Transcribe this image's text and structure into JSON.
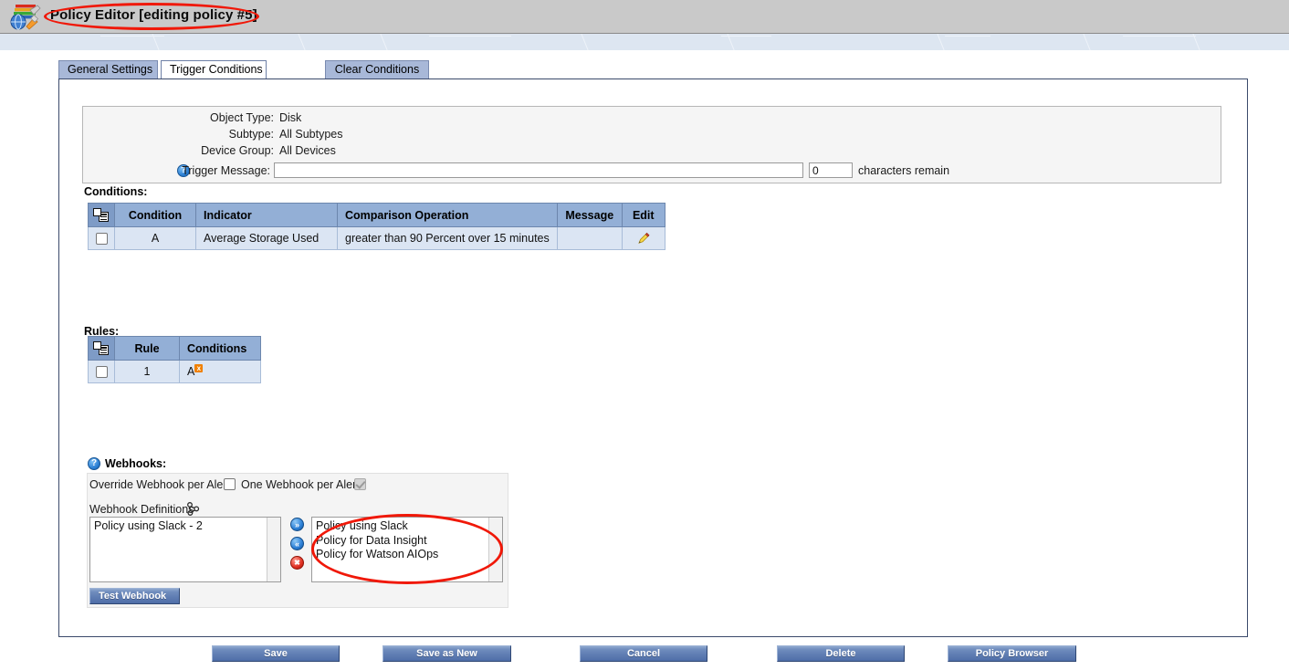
{
  "window": {
    "title": "Policy Editor [editing policy #5]",
    "app_icon": "policy-editor-icon",
    "highlight_color": "#f01808"
  },
  "tabs": [
    {
      "label": "General Settings",
      "active": false
    },
    {
      "label": "Trigger Conditions",
      "active": true
    },
    {
      "label": "Clear Conditions",
      "active": false
    }
  ],
  "info": {
    "object_type_label": "Object Type:",
    "object_type_value": "Disk",
    "subtype_label": "Subtype:",
    "subtype_value": "All Subtypes",
    "device_group_label": "Device Group:",
    "device_group_value": "All Devices",
    "trigger_message_label": "Trigger Message:",
    "trigger_message_value": "",
    "trigger_message_help": "?",
    "characters_count": "0",
    "characters_remain_label": "characters remain"
  },
  "conditions": {
    "section_label": "Conditions:",
    "columns": [
      "",
      "Condition",
      "Indicator",
      "Comparison Operation",
      "Message",
      "Edit"
    ],
    "rows": [
      {
        "checked": false,
        "condition": "A",
        "indicator": "Average Storage Used",
        "comparison": "greater than 90 Percent over 15 minutes",
        "message": "",
        "edit_icon": "pencil-icon"
      }
    ]
  },
  "rules": {
    "section_label": "Rules:",
    "columns": [
      "",
      "Rule",
      "Conditions"
    ],
    "rows": [
      {
        "checked": false,
        "rule": "1",
        "conditions": "A",
        "remove_badge": "x"
      }
    ]
  },
  "webhooks": {
    "section_label": "Webhooks:",
    "help_icon": "?",
    "override_label": "Override Webhook per Alert:",
    "override_checked": false,
    "one_per_alert_label": "One Webhook per Alert:",
    "one_per_alert_checked": true,
    "one_per_alert_disabled": true,
    "definitions_label": "Webhook Definitions",
    "definitions_icon": "share-network-icon",
    "selected_list": [
      "Policy using Slack - 2"
    ],
    "available_list": [
      "Policy using Slack",
      "Policy for Data Insight",
      "Policy for Watson AIOps"
    ],
    "add_button": "»",
    "remove_button": "«",
    "delete_button": "✖",
    "test_button": "Test Webhook"
  },
  "footer": {
    "buttons": [
      {
        "label": "Save"
      },
      {
        "label": "Save as New"
      },
      {
        "label": "Cancel"
      },
      {
        "label": "Delete"
      },
      {
        "label": "Policy Browser"
      }
    ]
  }
}
